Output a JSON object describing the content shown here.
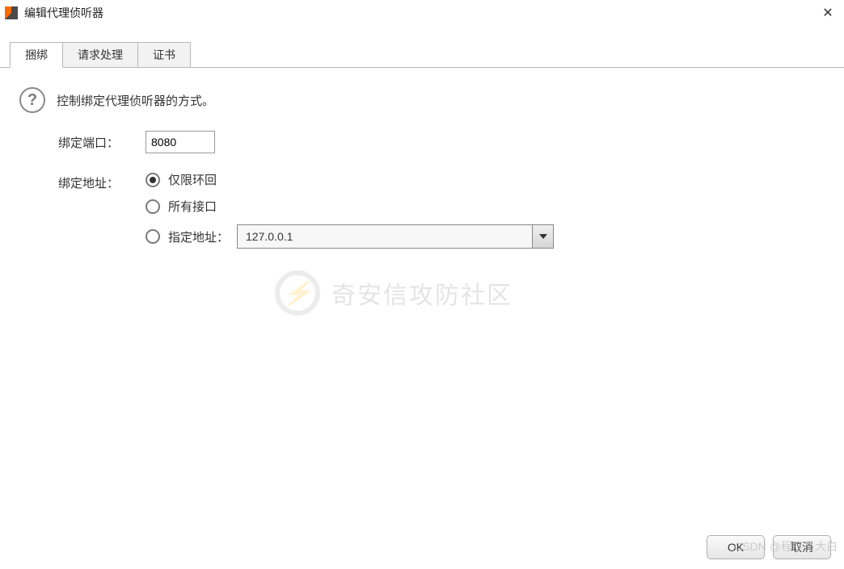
{
  "window": {
    "title": "编辑代理侦听器"
  },
  "tabs": {
    "binding": "捆绑",
    "request_handling": "请求处理",
    "certificate": "证书"
  },
  "binding_panel": {
    "description": "控制绑定代理侦听器的方式。",
    "port_label": "绑定端口：",
    "port_value": "8080",
    "address_label": "绑定地址：",
    "radio_loopback": "仅限环回",
    "radio_all": "所有接口",
    "radio_specific": "指定地址：",
    "specific_address_value": "127.0.0.1"
  },
  "buttons": {
    "ok": "OK",
    "cancel": "取消"
  },
  "watermark": {
    "text": "奇安信攻防社区",
    "csdn": "CSDN @程序员大白"
  }
}
